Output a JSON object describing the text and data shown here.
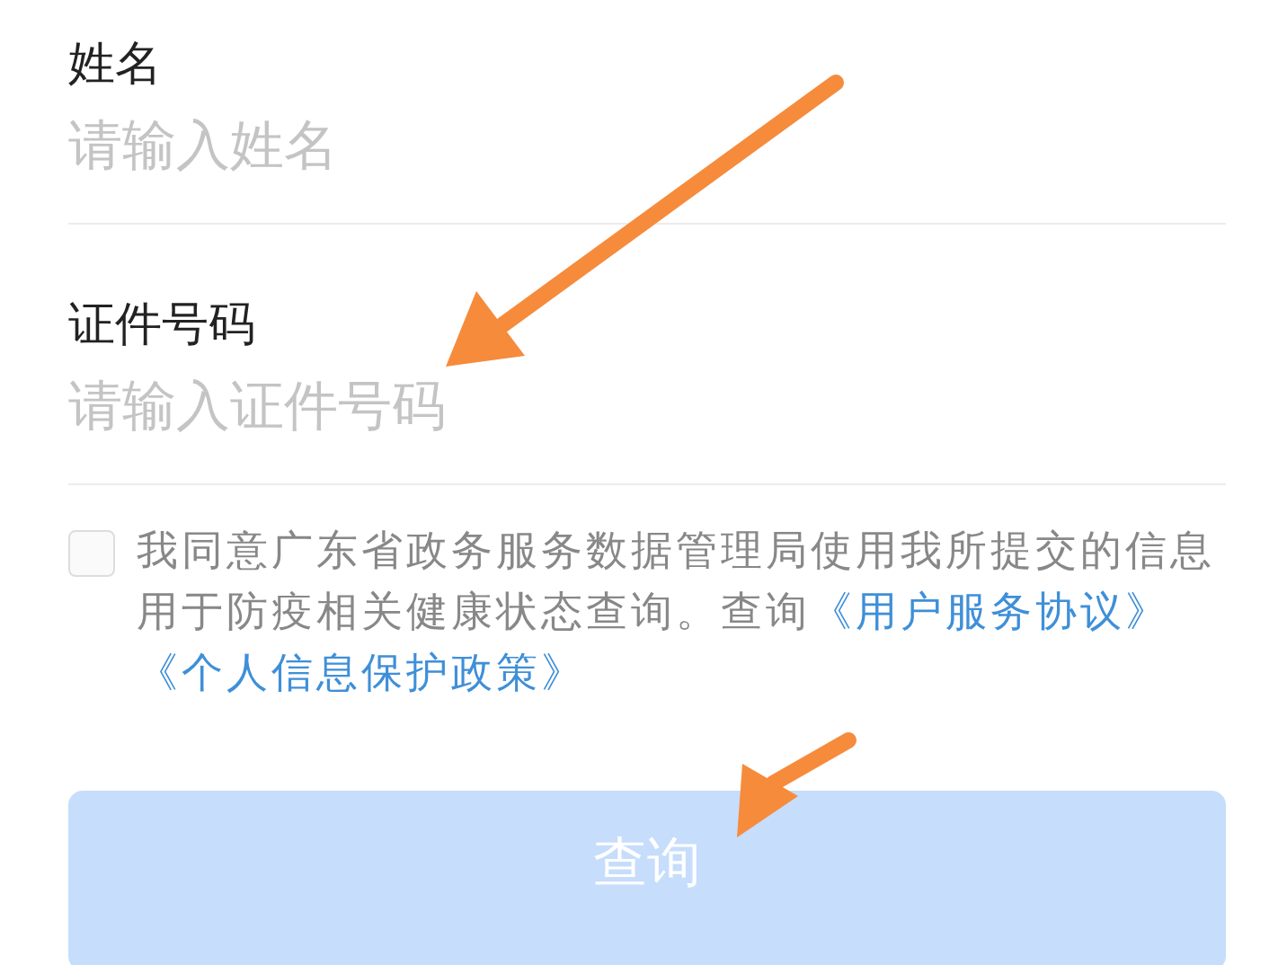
{
  "fields": [
    {
      "label": "姓名",
      "placeholder": "请输入姓名"
    },
    {
      "label": "证件号码",
      "placeholder": "请输入证件号码"
    }
  ],
  "agreement": {
    "checked": false,
    "text": "我同意广东省政务服务数据管理局使用我所提交的信息用于防疫相关健康状态查询。查询",
    "links": [
      "《用户服务协议》",
      "《个人信息保护政策》"
    ]
  },
  "submit_button": {
    "label": "查询",
    "disabled": true
  }
}
